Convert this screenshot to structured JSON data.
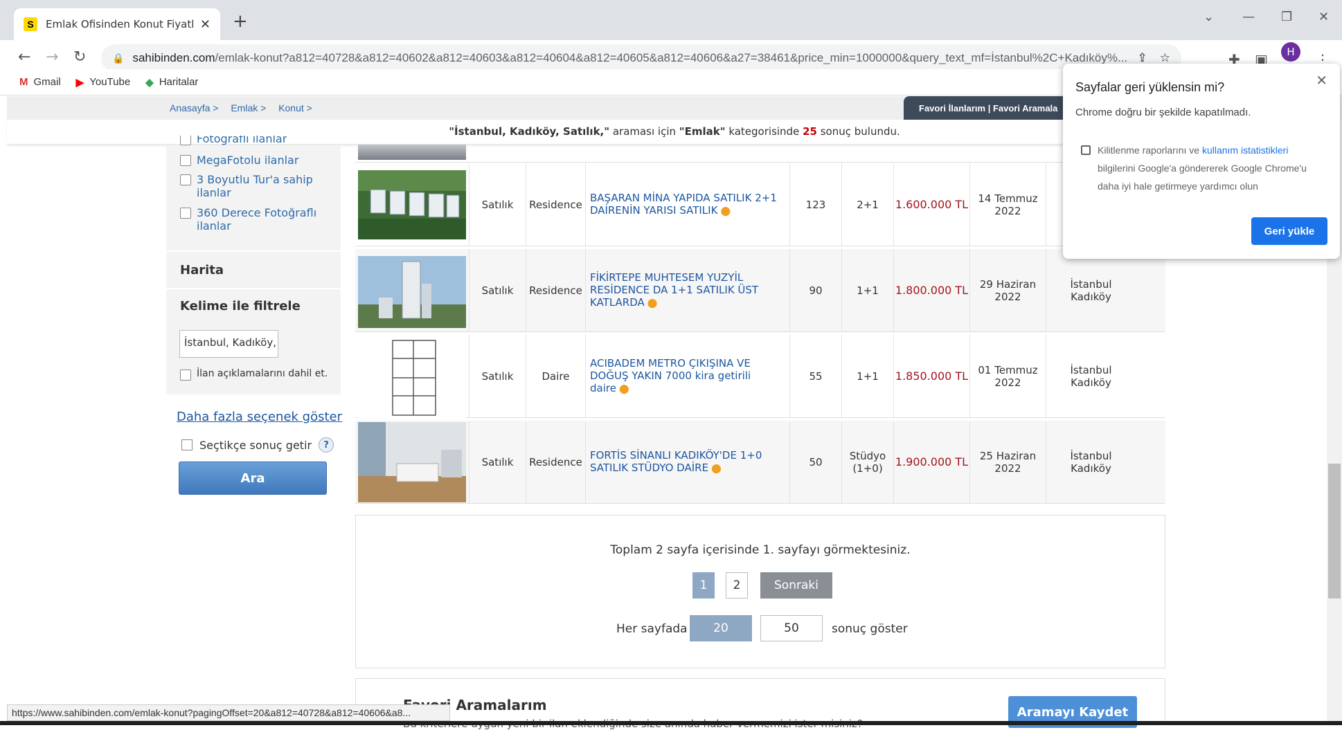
{
  "browser": {
    "tab_title": "Emlak Ofisinden Konut Fiyatları s",
    "url_host": "sahibinden.com",
    "url_rest": "/emlak-konut?a812=40728&a812=40602&a812=40603&a812=40604&a812=40605&a812=40606&a27=38461&price_min=1000000&query_text_mf=İstanbul%2C+Kadıköy%...",
    "bookmarks": [
      "Gmail",
      "YouTube",
      "Haritalar"
    ],
    "status_url": "https://www.sahibinden.com/emlak-konut?pagingOffset=20&a812=40728&a812=40606&a8..."
  },
  "breadcrumb": [
    "Anasayfa >",
    "Emlak >",
    "Konut >"
  ],
  "favorites_bar": "Favori İlanlarım  |  Favori Aramala",
  "result": {
    "query": "\"İstanbul, Kadıköy, Satılık,\"",
    "mid1": " araması için ",
    "category": "\"Emlak\"",
    "mid2": " kategorisinde ",
    "count": "25",
    "end": " sonuç bulundu."
  },
  "filters": {
    "items": [
      "Fotoğraflı ilanlar",
      "MegaFotolu ilanlar",
      "3 Boyutlu Tur'a sahip ilanlar",
      "360 Derece Fotoğraflı ilanlar"
    ],
    "map_heading": "Harita",
    "keyword_heading": "Kelime ile filtrele",
    "keyword_value": "İstanbul, Kadıköy,",
    "include_desc": "İlan açıklamalarını dahil et.",
    "more_link": "Daha fazla seçenek göster",
    "auto_search": "Seçtikçe sonuç getir",
    "help": "?",
    "search_button": "Ara"
  },
  "listings": [
    {
      "type": "Satılık",
      "kind": "Residence",
      "title": "BAŞARAN MİNA YAPIDA SATILIK 2+1 DAİRENİN YARISI SATILIK",
      "m2": "123",
      "rooms": "2+1",
      "price": "1.600.000 TL",
      "date": "14 Temmuz 2022",
      "loc": ""
    },
    {
      "type": "Satılık",
      "kind": "Residence",
      "title": "FİKİRTEPE MUHTESEM YUZYİL RESİDENCE DA 1+1 SATILIK ÜST KATLARDA",
      "m2": "90",
      "rooms": "1+1",
      "price": "1.800.000 TL",
      "date": "29 Haziran 2022",
      "loc": "İstanbul Kadıköy"
    },
    {
      "type": "Satılık",
      "kind": "Daire",
      "title": "ACIBADEM METRO ÇIKIŞINA VE DOĞUŞ YAKIN 7000 kira getirili daire",
      "m2": "55",
      "rooms": "1+1",
      "price": "1.850.000 TL",
      "date": "01 Temmuz 2022",
      "loc": "İstanbul Kadıköy"
    },
    {
      "type": "Satılık",
      "kind": "Residence",
      "title": "FORTİS SİNANLI KADIKÖY'DE 1+0 SATILIK STÜDYO DAİRE",
      "m2": "50",
      "rooms": "Stüdyo (1+0)",
      "price": "1.900.000 TL",
      "date": "25 Haziran 2022",
      "loc": "İstanbul Kadıköy"
    }
  ],
  "pager": {
    "text": "Toplam 2 sayfa içerisinde 1. sayfayı görmektesiniz.",
    "pages": [
      "1",
      "2"
    ],
    "next": "Sonraki",
    "per_page_label": "Her sayfada",
    "per_page_options": [
      "20",
      "50"
    ],
    "per_page_suffix": "sonuç göster"
  },
  "saved": {
    "heading": "Favori Aramalarım",
    "sub": "Bu kriterlere uygun yeni bir ilan eklendiğinde size anında haber vermemizi ister misiniz?",
    "button": "Aramayı Kaydet"
  },
  "dialog": {
    "title": "Sayfalar geri yüklensin mi?",
    "subtitle": "Chrome doğru bir şekilde kapatılmadı.",
    "check_pre": "Kilitlenme raporlarını ve ",
    "check_link": "kullanım istatistikleri",
    "check_post": " bilgilerini Google'a göndererek Google Chrome'u daha iyi hale getirmeye yardımcı olun",
    "button": "Geri yükle"
  }
}
